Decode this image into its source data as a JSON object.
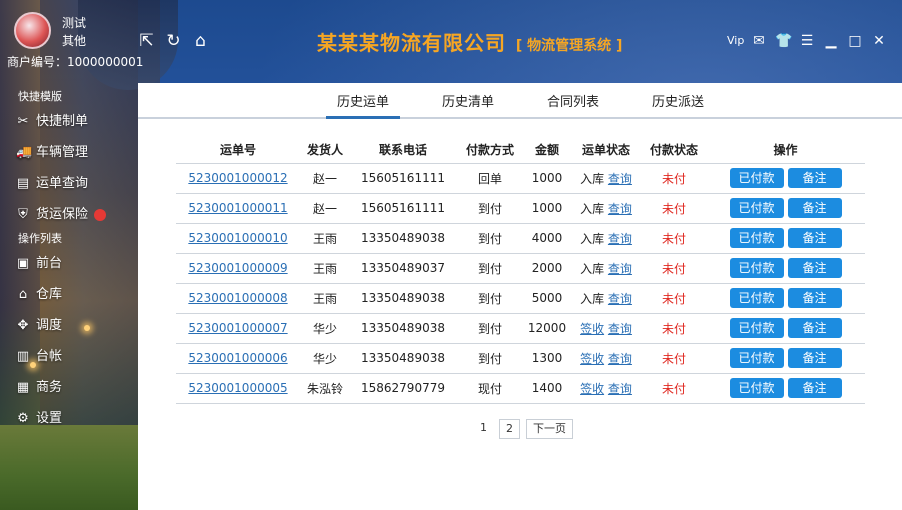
{
  "user": {
    "name": "测试",
    "role": "其他",
    "merchant_label": "商户编号：",
    "merchant_id": "1000000001"
  },
  "brand": {
    "company": "某某某物流有限公司",
    "system": "[ 物流管理系统 ]"
  },
  "toolbar_icons": [
    "expand-icon",
    "refresh-icon",
    "home-icon"
  ],
  "window_controls": {
    "vip": "Vip",
    "mail": "mail-icon",
    "skin": "shirt-icon",
    "menu": "menu-icon",
    "minimize": "minimize-icon",
    "maximize": "maximize-icon",
    "close": "close-icon"
  },
  "sidebar": {
    "section_shortcuts": "快捷模版",
    "shortcuts": [
      {
        "label": "快捷制单",
        "icon": "wrench-icon"
      },
      {
        "label": "车辆管理",
        "icon": "truck-icon"
      },
      {
        "label": "运单查询",
        "icon": "document-icon"
      },
      {
        "label": "货运保险",
        "icon": "shield-icon"
      }
    ],
    "section_ops": "操作列表",
    "ops": [
      {
        "label": "前台",
        "icon": "desk-icon"
      },
      {
        "label": "仓库",
        "icon": "warehouse-icon"
      },
      {
        "label": "调度",
        "icon": "dispatch-icon"
      },
      {
        "label": "台帐",
        "icon": "ledger-icon"
      },
      {
        "label": "商务",
        "icon": "briefcase-icon"
      },
      {
        "label": "设置",
        "icon": "gear-icon"
      }
    ]
  },
  "tabs": [
    "历史运单",
    "历史清单",
    "合同列表",
    "历史派送"
  ],
  "active_tab": "历史运单",
  "table": {
    "headers": [
      "运单号",
      "发货人",
      "联系电话",
      "付款方式",
      "金额",
      "运单状态",
      "付款状态",
      "操作"
    ],
    "rows": [
      {
        "waybill": "5230001000012",
        "shipper": "赵一",
        "phone": "15605161111",
        "payment": "回单",
        "amount": "1000",
        "status": "入库",
        "status_link": "查询",
        "pay_status": "未付"
      },
      {
        "waybill": "5230001000011",
        "shipper": "赵一",
        "phone": "15605161111",
        "payment": "到付",
        "amount": "1000",
        "status": "入库",
        "status_link": "查询",
        "pay_status": "未付"
      },
      {
        "waybill": "5230001000010",
        "shipper": "王雨",
        "phone": "13350489038",
        "payment": "到付",
        "amount": "4000",
        "status": "入库",
        "status_link": "查询",
        "pay_status": "未付"
      },
      {
        "waybill": "5230001000009",
        "shipper": "王雨",
        "phone": "13350489037",
        "payment": "到付",
        "amount": "2000",
        "status": "入库",
        "status_link": "查询",
        "pay_status": "未付"
      },
      {
        "waybill": "5230001000008",
        "shipper": "王雨",
        "phone": "13350489038",
        "payment": "到付",
        "amount": "5000",
        "status": "入库",
        "status_link": "查询",
        "pay_status": "未付"
      },
      {
        "waybill": "5230001000007",
        "shipper": "华少",
        "phone": "13350489038",
        "payment": "到付",
        "amount": "12000",
        "status": "签收",
        "status_link": "查询",
        "pay_status": "未付"
      },
      {
        "waybill": "5230001000006",
        "shipper": "华少",
        "phone": "13350489038",
        "payment": "到付",
        "amount": "1300",
        "status": "签收",
        "status_link": "查询",
        "pay_status": "未付"
      },
      {
        "waybill": "5230001000005",
        "shipper": "朱泓铃",
        "phone": "15862790779",
        "payment": "现付",
        "amount": "1400",
        "status": "签收",
        "status_link": "查询",
        "pay_status": "未付"
      }
    ],
    "btn_paid": "已付款",
    "btn_remark": "备注"
  },
  "pager": {
    "current": "1",
    "page2": "2",
    "next": "下一页"
  },
  "colors": {
    "accent": "#1c8ce0",
    "brand": "#f6a623",
    "unpaid": "#e0271f",
    "link": "#2a6fb5"
  }
}
